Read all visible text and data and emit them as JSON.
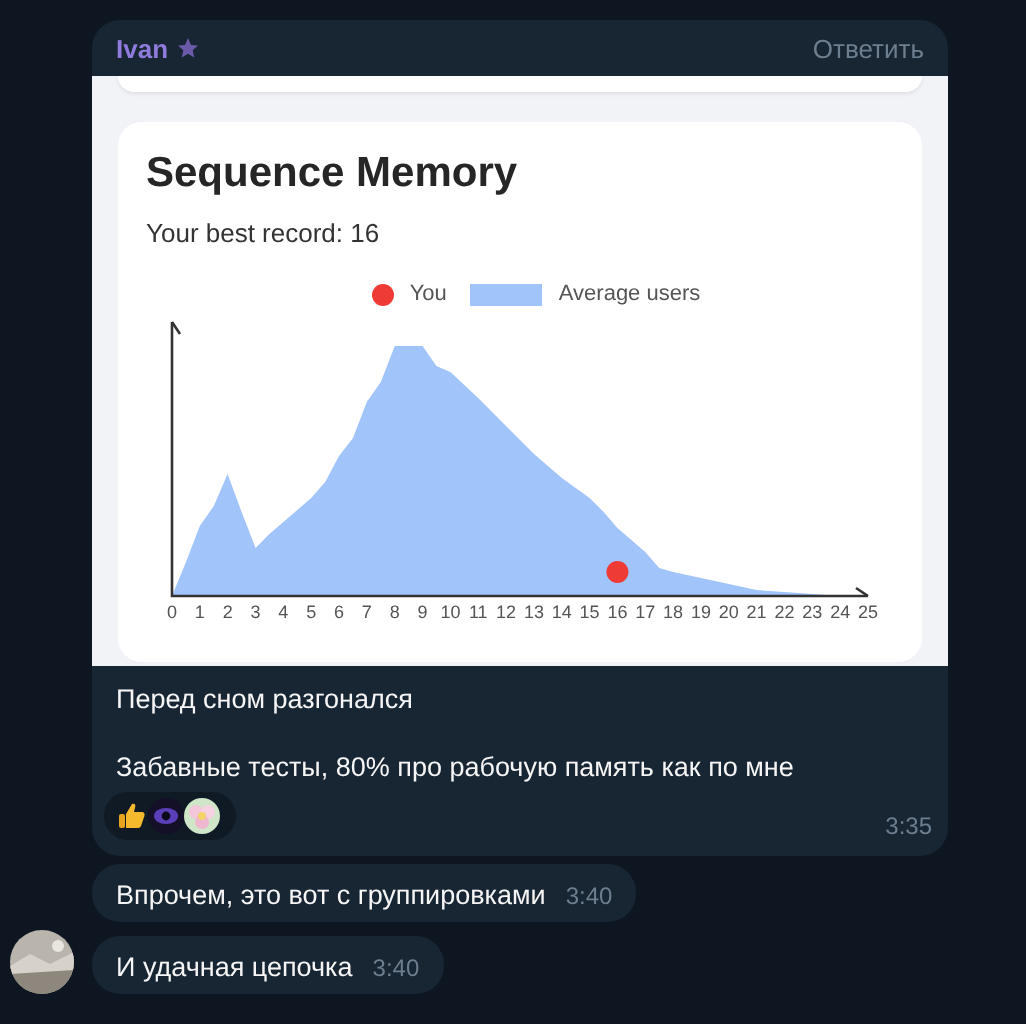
{
  "message": {
    "sender": "Ivan",
    "reply_action": "Ответить",
    "card": {
      "title": "Sequence Memory",
      "subtitle": "Your best record: 16",
      "legend": [
        {
          "label": "You",
          "kind": "dot",
          "color": "#ef3b36"
        },
        {
          "label": "Average users",
          "kind": "area",
          "color": "#a1c4fb"
        }
      ],
      "x_labels": [
        "0",
        "1",
        "2",
        "3",
        "4",
        "5",
        "6",
        "7",
        "8",
        "9",
        "10",
        "11",
        "12",
        "13",
        "14",
        "15",
        "16",
        "17",
        "18",
        "19",
        "20",
        "21",
        "22",
        "23",
        "24",
        "25"
      ]
    },
    "caption": [
      "Перед сном разгонался",
      "Забавные тесты, 80% про рабочую память как по мне"
    ],
    "time": "3:35"
  },
  "follow_ups": [
    {
      "text": "Впрочем, это вот с группировками",
      "time": "3:40",
      "avatar": false
    },
    {
      "text": "И удачная цепочка",
      "time": "3:40",
      "avatar": true
    }
  ]
}
